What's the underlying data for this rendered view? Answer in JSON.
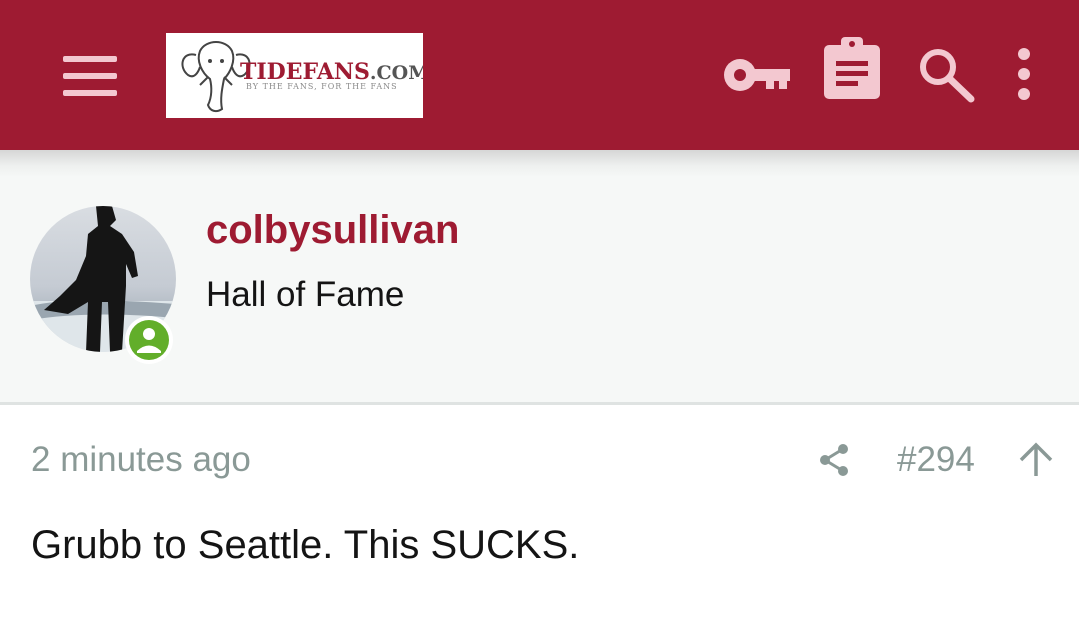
{
  "header": {
    "logo": {
      "brand": "TIDEFANS",
      "tld": ".COM",
      "tagline": "BY THE FANS, FOR THE FANS"
    },
    "icons": [
      "menu-icon",
      "key-icon",
      "clipboard-icon",
      "search-icon",
      "more-vertical-icon"
    ],
    "colors": {
      "bar": "#9e1b32",
      "icon": "#f3c8d0"
    }
  },
  "post": {
    "author": {
      "username": "colbysullivan",
      "title": "Hall of Fame",
      "status": "online",
      "status_color": "#62ae2a"
    },
    "time": "2 minutes ago",
    "number": "#294",
    "actions": [
      "share-icon",
      "arrow-up-icon"
    ],
    "body": "Grubb to Seattle. This SUCKS."
  }
}
